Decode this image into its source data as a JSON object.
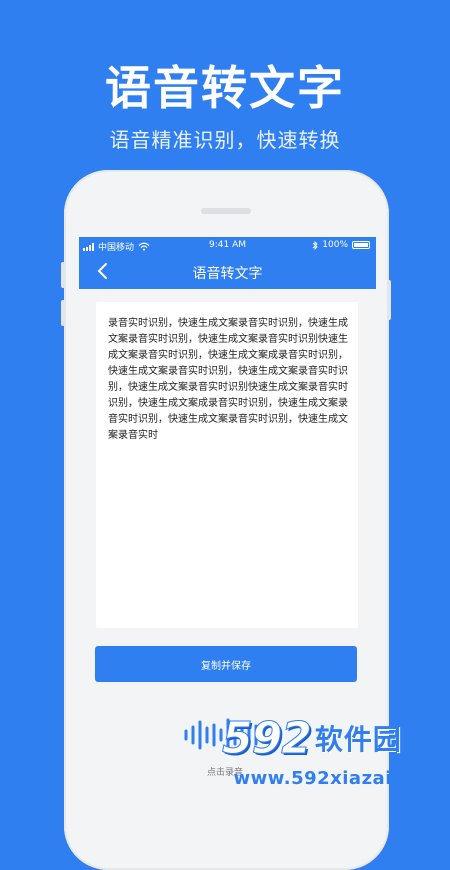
{
  "hero": {
    "title": "语音转文字",
    "subtitle": "语音精准识别，快速转换"
  },
  "status_bar": {
    "carrier": "中国移动",
    "time": "9:41 AM",
    "battery": "100%"
  },
  "nav": {
    "title": "语音转文字"
  },
  "transcript": {
    "text": "录音实时识别，快速生成文案录音实时识别，快速生成文案录音实时识别，快速生成文案录音实时识别快速生成文案录音实时识别，快速生成文案成录音实时识别，快速生成文案录音实时识别，快速生成文案录音实时识别，快速生成文案录音实时识别快速生成文案录音实时识别，快速生成文案成录音实时识别，快速生成文案录音实时识别，快速生成文案录音实时识别，快速生成文案录音实时"
  },
  "actions": {
    "copy_save_label": "复制并保存",
    "tap_to_record_label": "点击录音"
  },
  "watermark": {
    "logo_number": "592",
    "logo_text": "软件园",
    "url": "www.592xiazai.com"
  },
  "colors": {
    "accent": "#2f7ff0",
    "background": "#2f7ff0",
    "card": "#ffffff",
    "phone_body": "#f3f4f6"
  },
  "icons": {
    "back": "chevron-left-icon",
    "wifi": "wifi-icon",
    "signal": "signal-icon",
    "bluetooth": "bluetooth-icon",
    "battery": "battery-icon",
    "mic": "waveform-icon"
  }
}
